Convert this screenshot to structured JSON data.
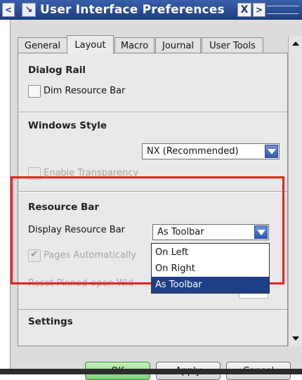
{
  "window": {
    "title": "User Interface Preferences",
    "nav_left": "<",
    "nav_right": ">",
    "close": "X",
    "icon": "resource-arrow-icon"
  },
  "tabs": [
    {
      "label": "General",
      "active": false
    },
    {
      "label": "Layout",
      "active": true
    },
    {
      "label": "Macro",
      "active": false
    },
    {
      "label": "Journal",
      "active": false
    },
    {
      "label": "User Tools",
      "active": false
    }
  ],
  "dialog_rail": {
    "title": "Dialog Rail",
    "dim_label": "Dim Resource Bar"
  },
  "windows_style": {
    "title": "Windows Style",
    "style_value": "NX (Recommended)",
    "transparency_label": "Enable Transparency"
  },
  "resource_bar": {
    "title": "Resource Bar",
    "display_label": "Display Resource Bar",
    "display_value": "As Toolbar",
    "pages_label": "Pages Automatically",
    "reset_label": "Reset Pinned-open Wid",
    "options": [
      "On Left",
      "On Right",
      "As Toolbar"
    ],
    "selected_option": "As Toolbar"
  },
  "settings": {
    "title": "Settings"
  },
  "buttons": {
    "ok": "OK",
    "apply": "Apply",
    "cancel": "Cancel"
  },
  "colors": {
    "title_bar": "#1f3f86",
    "highlight_border": "#e8201c",
    "ok_button": "#7bd27a",
    "dropdown_arrow": "#2c59b2"
  }
}
